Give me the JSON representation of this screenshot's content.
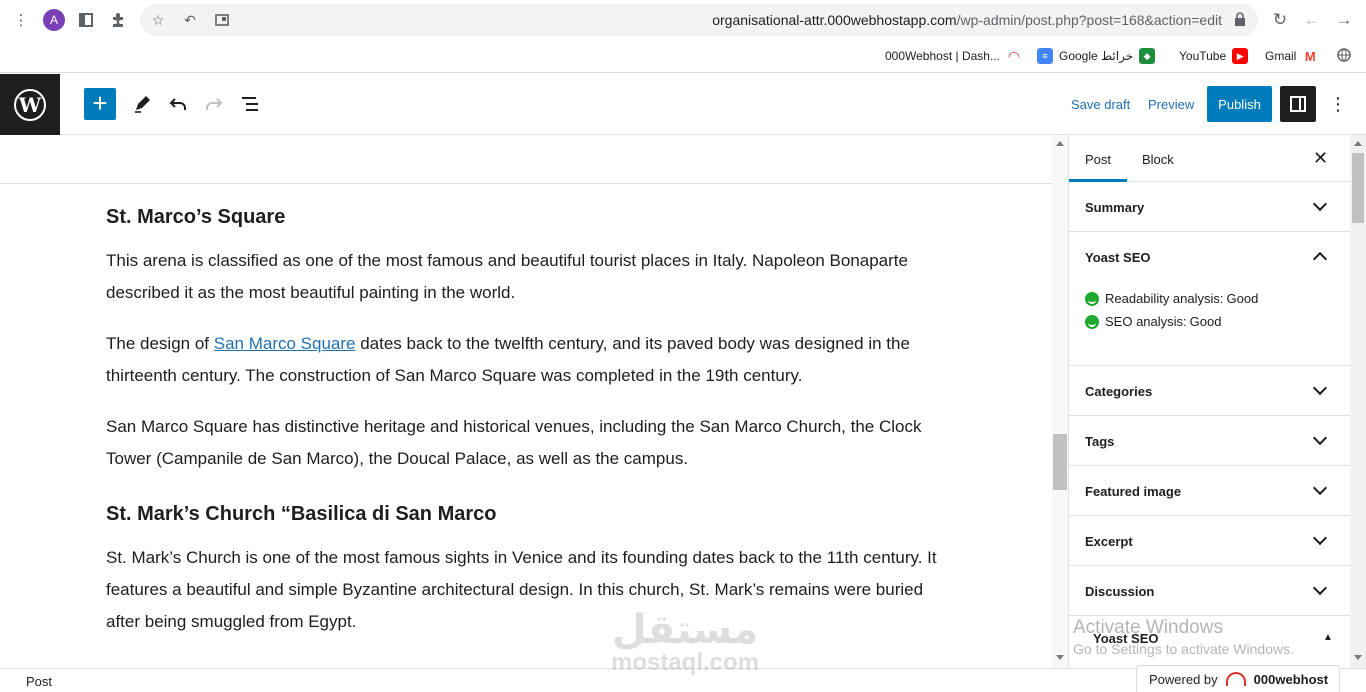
{
  "browser": {
    "avatar_letter": "A",
    "url_host": "organisational-attr.000webhostapp.com",
    "url_path": "/wp-admin/post.php?post=168&action=edit",
    "bookmarks": [
      {
        "label": "000Webhost | Dash...",
        "icon": "webhost-icon",
        "color": "#d7352b"
      },
      {
        "label": "Google خرائط",
        "icon": "maps-icon",
        "color": "#1e8e3e"
      },
      {
        "label": "YouTube",
        "icon": "youtube-icon",
        "color": "#ff0000"
      },
      {
        "label": "Gmail",
        "icon": "gmail-icon",
        "color": "#ea4335"
      }
    ]
  },
  "toolbar": {
    "save_draft": "Save draft",
    "preview": "Preview",
    "publish": "Publish"
  },
  "content": {
    "h1": "St. Marco’s Square",
    "p1": "This arena is classified as one of the most famous and beautiful tourist places in Italy. Napoleon Bonaparte described it as the most beautiful painting in the world.",
    "p2_before": "The design of ",
    "p2_link": "San Marco Square",
    "p2_after": " dates back to the twelfth century, and its paved body was designed in the thirteenth century. The construction of San Marco Square was completed in the 19th century.",
    "p3": "San Marco Square has distinctive heritage and historical venues, including the San Marco Church, the Clock Tower (Campanile de San Marco), the Doucal Palace, as well as the campus.",
    "h2": "St. Mark’s Church “Basilica di San Marco",
    "p4": "St. Mark’s Church is one of the most famous sights in Venice and its founding dates back to the 11th century. It features a beautiful and simple Byzantine architectural design. In this church, St. Mark’s remains were buried after being smuggled from Egypt."
  },
  "sidebar": {
    "tab_post": "Post",
    "tab_block": "Block",
    "summary": "Summary",
    "yoast": "Yoast SEO",
    "readability_label": "Readability analysis:",
    "readability_value": "Good",
    "seo_label": "SEO analysis:",
    "seo_value": "Good",
    "categories": "Categories",
    "tags": "Tags",
    "featured_image": "Featured image",
    "excerpt": "Excerpt",
    "discussion": "Discussion",
    "yoast_bottom": "Yoast SEO"
  },
  "status": {
    "breadcrumb": "Post",
    "powered_by": "Powered by",
    "powered_brand": "000webhost"
  },
  "overlay": {
    "watermark_ar": "مستقل",
    "watermark_en": "mostaql.com",
    "activate_title": "Activate Windows",
    "activate_sub": "Go to Settings to activate Windows."
  },
  "colors": {
    "accent": "#007cba",
    "link": "#2271b1",
    "good": "#1fa92f"
  }
}
